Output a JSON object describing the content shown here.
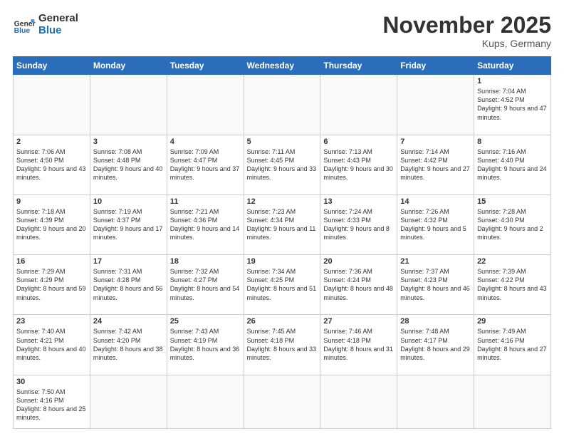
{
  "header": {
    "logo_general": "General",
    "logo_blue": "Blue",
    "month": "November 2025",
    "location": "Kups, Germany"
  },
  "weekdays": [
    "Sunday",
    "Monday",
    "Tuesday",
    "Wednesday",
    "Thursday",
    "Friday",
    "Saturday"
  ],
  "weeks": [
    [
      {
        "day": "",
        "info": ""
      },
      {
        "day": "",
        "info": ""
      },
      {
        "day": "",
        "info": ""
      },
      {
        "day": "",
        "info": ""
      },
      {
        "day": "",
        "info": ""
      },
      {
        "day": "",
        "info": ""
      },
      {
        "day": "1",
        "info": "Sunrise: 7:04 AM\nSunset: 4:52 PM\nDaylight: 9 hours and 47 minutes."
      }
    ],
    [
      {
        "day": "2",
        "info": "Sunrise: 7:06 AM\nSunset: 4:50 PM\nDaylight: 9 hours and 43 minutes."
      },
      {
        "day": "3",
        "info": "Sunrise: 7:08 AM\nSunset: 4:48 PM\nDaylight: 9 hours and 40 minutes."
      },
      {
        "day": "4",
        "info": "Sunrise: 7:09 AM\nSunset: 4:47 PM\nDaylight: 9 hours and 37 minutes."
      },
      {
        "day": "5",
        "info": "Sunrise: 7:11 AM\nSunset: 4:45 PM\nDaylight: 9 hours and 33 minutes."
      },
      {
        "day": "6",
        "info": "Sunrise: 7:13 AM\nSunset: 4:43 PM\nDaylight: 9 hours and 30 minutes."
      },
      {
        "day": "7",
        "info": "Sunrise: 7:14 AM\nSunset: 4:42 PM\nDaylight: 9 hours and 27 minutes."
      },
      {
        "day": "8",
        "info": "Sunrise: 7:16 AM\nSunset: 4:40 PM\nDaylight: 9 hours and 24 minutes."
      }
    ],
    [
      {
        "day": "9",
        "info": "Sunrise: 7:18 AM\nSunset: 4:39 PM\nDaylight: 9 hours and 20 minutes."
      },
      {
        "day": "10",
        "info": "Sunrise: 7:19 AM\nSunset: 4:37 PM\nDaylight: 9 hours and 17 minutes."
      },
      {
        "day": "11",
        "info": "Sunrise: 7:21 AM\nSunset: 4:36 PM\nDaylight: 9 hours and 14 minutes."
      },
      {
        "day": "12",
        "info": "Sunrise: 7:23 AM\nSunset: 4:34 PM\nDaylight: 9 hours and 11 minutes."
      },
      {
        "day": "13",
        "info": "Sunrise: 7:24 AM\nSunset: 4:33 PM\nDaylight: 9 hours and 8 minutes."
      },
      {
        "day": "14",
        "info": "Sunrise: 7:26 AM\nSunset: 4:32 PM\nDaylight: 9 hours and 5 minutes."
      },
      {
        "day": "15",
        "info": "Sunrise: 7:28 AM\nSunset: 4:30 PM\nDaylight: 9 hours and 2 minutes."
      }
    ],
    [
      {
        "day": "16",
        "info": "Sunrise: 7:29 AM\nSunset: 4:29 PM\nDaylight: 8 hours and 59 minutes."
      },
      {
        "day": "17",
        "info": "Sunrise: 7:31 AM\nSunset: 4:28 PM\nDaylight: 8 hours and 56 minutes."
      },
      {
        "day": "18",
        "info": "Sunrise: 7:32 AM\nSunset: 4:27 PM\nDaylight: 8 hours and 54 minutes."
      },
      {
        "day": "19",
        "info": "Sunrise: 7:34 AM\nSunset: 4:25 PM\nDaylight: 8 hours and 51 minutes."
      },
      {
        "day": "20",
        "info": "Sunrise: 7:36 AM\nSunset: 4:24 PM\nDaylight: 8 hours and 48 minutes."
      },
      {
        "day": "21",
        "info": "Sunrise: 7:37 AM\nSunset: 4:23 PM\nDaylight: 8 hours and 46 minutes."
      },
      {
        "day": "22",
        "info": "Sunrise: 7:39 AM\nSunset: 4:22 PM\nDaylight: 8 hours and 43 minutes."
      }
    ],
    [
      {
        "day": "23",
        "info": "Sunrise: 7:40 AM\nSunset: 4:21 PM\nDaylight: 8 hours and 40 minutes."
      },
      {
        "day": "24",
        "info": "Sunrise: 7:42 AM\nSunset: 4:20 PM\nDaylight: 8 hours and 38 minutes."
      },
      {
        "day": "25",
        "info": "Sunrise: 7:43 AM\nSunset: 4:19 PM\nDaylight: 8 hours and 36 minutes."
      },
      {
        "day": "26",
        "info": "Sunrise: 7:45 AM\nSunset: 4:18 PM\nDaylight: 8 hours and 33 minutes."
      },
      {
        "day": "27",
        "info": "Sunrise: 7:46 AM\nSunset: 4:18 PM\nDaylight: 8 hours and 31 minutes."
      },
      {
        "day": "28",
        "info": "Sunrise: 7:48 AM\nSunset: 4:17 PM\nDaylight: 8 hours and 29 minutes."
      },
      {
        "day": "29",
        "info": "Sunrise: 7:49 AM\nSunset: 4:16 PM\nDaylight: 8 hours and 27 minutes."
      }
    ],
    [
      {
        "day": "30",
        "info": "Sunrise: 7:50 AM\nSunset: 4:16 PM\nDaylight: 8 hours and 25 minutes."
      },
      {
        "day": "",
        "info": ""
      },
      {
        "day": "",
        "info": ""
      },
      {
        "day": "",
        "info": ""
      },
      {
        "day": "",
        "info": ""
      },
      {
        "day": "",
        "info": ""
      },
      {
        "day": "",
        "info": ""
      }
    ]
  ]
}
